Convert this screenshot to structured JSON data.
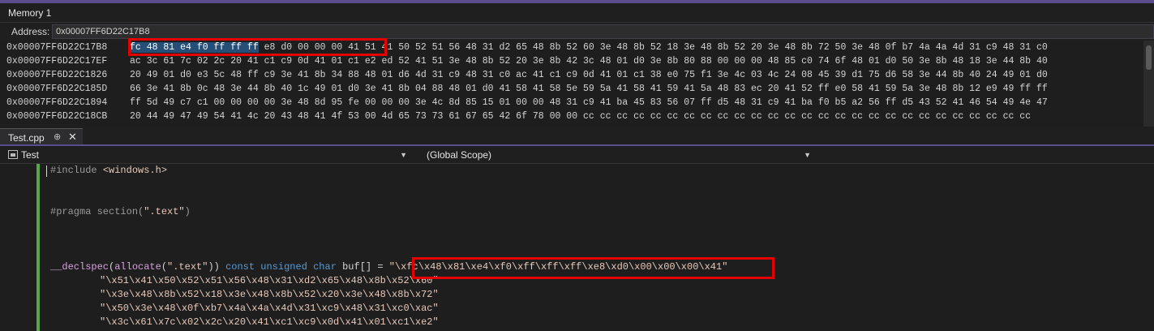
{
  "memory_window": {
    "title": "Memory 1",
    "address_label": "Address:",
    "address_value": "0x00007FF6D22C17B8",
    "rows": [
      {
        "address": "0x00007FF6D22C17B8",
        "selected": "fc 48 81 e4 f0 ff ff ff",
        "bytes": " e8 d0 00 00 00 41 51 41 50 52 51 56 48 31 d2 65 48 8b 52 60 3e 48 8b 52 18 3e 48 8b 52 20 3e 48 8b 72 50 3e 48 0f b7 4a 4a 4d 31 c9 48 31 c0"
      },
      {
        "address": "0x00007FF6D22C17EF",
        "selected": "",
        "bytes": "ac 3c 61 7c 02 2c 20 41 c1 c9 0d 41 01 c1 e2 ed 52 41 51 3e 48 8b 52 20 3e 8b 42 3c 48 01 d0 3e 8b 80 88 00 00 00 48 85 c0 74 6f 48 01 d0 50 3e 8b 48 18 3e 44 8b 40"
      },
      {
        "address": "0x00007FF6D22C1826",
        "selected": "",
        "bytes": "20 49 01 d0 e3 5c 48 ff c9 3e 41 8b 34 88 48 01 d6 4d 31 c9 48 31 c0 ac 41 c1 c9 0d 41 01 c1 38 e0 75 f1 3e 4c 03 4c 24 08 45 39 d1 75 d6 58 3e 44 8b 40 24 49 01 d0"
      },
      {
        "address": "0x00007FF6D22C185D",
        "selected": "",
        "bytes": "66 3e 41 8b 0c 48 3e 44 8b 40 1c 49 01 d0 3e 41 8b 04 88 48 01 d0 41 58 41 58 5e 59 5a 41 58 41 59 41 5a 48 83 ec 20 41 52 ff e0 58 41 59 5a 3e 48 8b 12 e9 49 ff ff"
      },
      {
        "address": "0x00007FF6D22C1894",
        "selected": "",
        "bytes": "ff 5d 49 c7 c1 00 00 00 00 3e 48 8d 95 fe 00 00 00 3e 4c 8d 85 15 01 00 00 48 31 c9 41 ba 45 83 56 07 ff d5 48 31 c9 41 ba f0 b5 a2 56 ff d5 43 52 41 46 54 49 4e 47"
      },
      {
        "address": "0x00007FF6D22C18CB",
        "selected": "",
        "bytes": "20 44 49 47 49 54 41 4c 20 43 48 41 4f 53 00 4d 65 73 73 61 67 65 42 6f 78 00 00 cc cc cc cc cc cc cc cc cc cc cc cc cc cc cc cc cc cc cc cc cc cc cc cc cc cc cc"
      }
    ]
  },
  "editor": {
    "tab_label": "Test.cpp",
    "tab_pin": "⊕",
    "tab_close": "✕",
    "project_dropdown": "Test",
    "scope_dropdown": "(Global Scope)",
    "lines": {
      "l1_directive": "#include",
      "l1_header": "<windows.h>",
      "l2_directive": "#pragma section(",
      "l2_str": "\".text\"",
      "l2_close": ")",
      "l3_declspec": "__declspec",
      "l3_p1": "(",
      "l3_allocate": "allocate",
      "l3_p2": "(",
      "l3_text": "\".text\"",
      "l3_p3": "))",
      "l3_const": "const",
      "l3_unsigned": "unsigned",
      "l3_char": "char",
      "l3_buf": "buf",
      "l3_rest": "[] = ",
      "l3_string": "\"\\xfc\\x48\\x81\\xe4\\xf0\\xff\\xff\\xff\\xe8\\xd0\\x00\\x00\\x00\\x41\"",
      "l4": "\"\\x51\\x41\\x50\\x52\\x51\\x56\\x48\\x31\\xd2\\x65\\x48\\x8b\\x52\\x60\"",
      "l5": "\"\\x3e\\x48\\x8b\\x52\\x18\\x3e\\x48\\x8b\\x52\\x20\\x3e\\x48\\x8b\\x72\"",
      "l6": "\"\\x50\\x3e\\x48\\x0f\\xb7\\x4a\\x4a\\x4d\\x31\\xc9\\x48\\x31\\xc0\\xac\"",
      "l7": "\"\\x3c\\x61\\x7c\\x02\\x2c\\x20\\x41\\xc1\\xc9\\x0d\\x41\\x01\\xc1\\xe2\""
    }
  },
  "colors": {
    "accent_purple": "#5a4d8e",
    "highlight_red": "#e50000",
    "selection_blue": "#264f78",
    "gutter_green": "#57a64a"
  }
}
